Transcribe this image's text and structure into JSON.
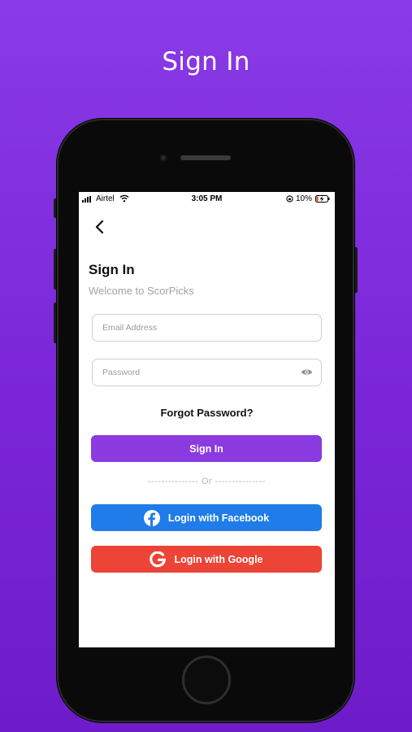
{
  "headline": "Sign In",
  "status_bar": {
    "carrier": "Airtel",
    "time": "3:05 PM",
    "battery": "10%"
  },
  "screen": {
    "title": "Sign In",
    "subtitle": "Welcome to ScorPicks",
    "email": {
      "placeholder": "Email Address",
      "value": ""
    },
    "password": {
      "placeholder": "Password",
      "value": ""
    },
    "forgot_password": "Forgot Password?",
    "signin_button": "Sign In",
    "divider": "--------------- Or ---------------",
    "facebook_button": "Login with Facebook",
    "google_button": "Login with Google"
  },
  "icons": {
    "back": "chevron-left-icon",
    "eye": "eye-icon",
    "facebook": "facebook-icon",
    "google": "google-icon"
  },
  "colors": {
    "background": "#8a3ae6",
    "primary": "#8b3ae0",
    "facebook": "#1f7ce8",
    "google": "#ec4436"
  }
}
